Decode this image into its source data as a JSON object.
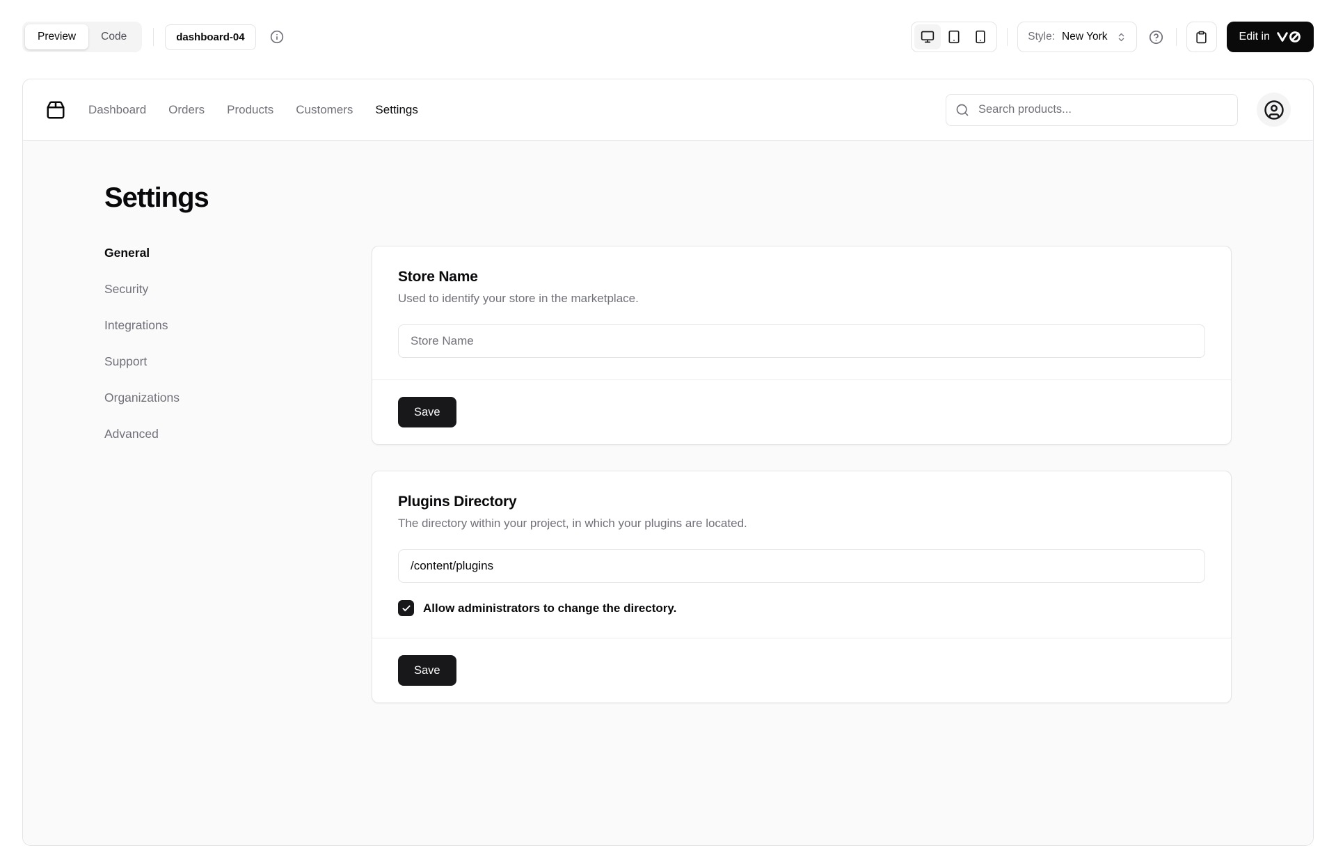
{
  "toolbar": {
    "view_tabs": {
      "preview_label": "Preview",
      "code_label": "Code",
      "active": "Preview"
    },
    "block_name": "dashboard-04",
    "devices": [
      "desktop",
      "tablet",
      "mobile"
    ],
    "active_device": "desktop",
    "style": {
      "label": "Style:",
      "value": "New York"
    },
    "edit_button": {
      "text": "Edit in",
      "logo": "v0"
    }
  },
  "nav": {
    "brand_icon": "package-icon",
    "items": [
      {
        "label": "Dashboard",
        "active": false
      },
      {
        "label": "Orders",
        "active": false
      },
      {
        "label": "Products",
        "active": false
      },
      {
        "label": "Customers",
        "active": false
      },
      {
        "label": "Settings",
        "active": true
      }
    ],
    "search": {
      "placeholder": "Search products..."
    }
  },
  "settings": {
    "title": "Settings",
    "sidebar": {
      "items": [
        {
          "label": "General",
          "active": true
        },
        {
          "label": "Security",
          "active": false
        },
        {
          "label": "Integrations",
          "active": false
        },
        {
          "label": "Support",
          "active": false
        },
        {
          "label": "Organizations",
          "active": false
        },
        {
          "label": "Advanced",
          "active": false
        }
      ]
    },
    "cards": [
      {
        "title": "Store Name",
        "description": "Used to identify your store in the marketplace.",
        "input": {
          "placeholder": "Store Name",
          "value": ""
        },
        "save_label": "Save"
      },
      {
        "title": "Plugins Directory",
        "description": "The directory within your project, in which your plugins are located.",
        "input": {
          "value": "/content/plugins"
        },
        "checkbox": {
          "checked": true,
          "label": "Allow administrators to change the directory."
        },
        "save_label": "Save"
      }
    ]
  },
  "colors": {
    "accent": "#18181b",
    "muted_text": "#71717a",
    "border": "#e4e4e7",
    "muted_bg": "#f4f4f5",
    "main_bg": "#fafafa"
  }
}
